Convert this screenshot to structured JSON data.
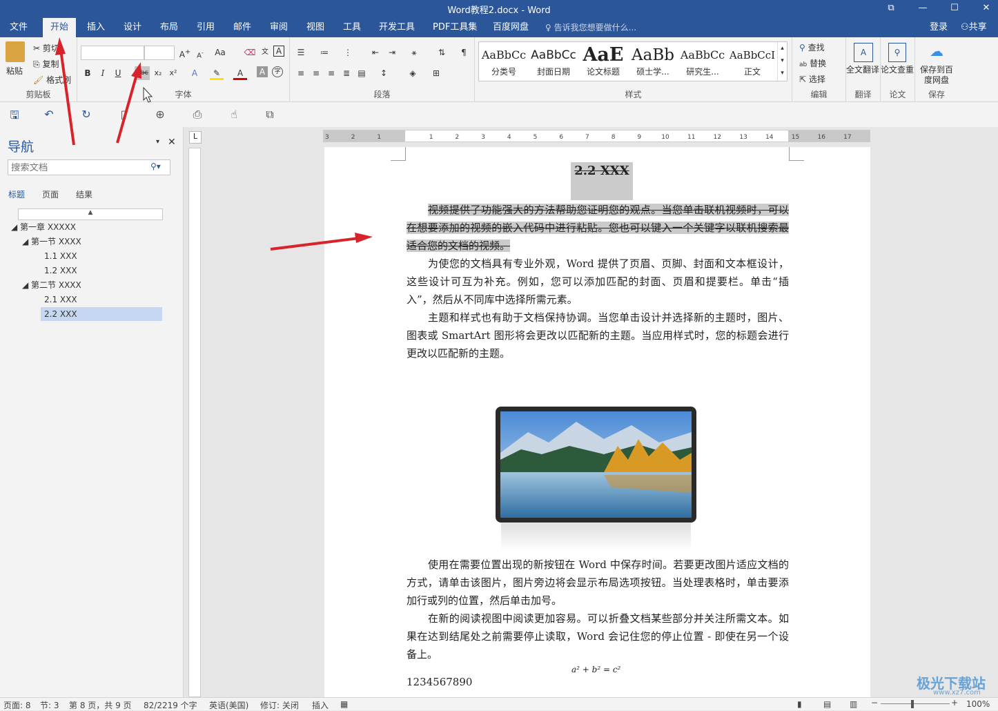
{
  "window": {
    "title": "Word教程2.docx - Word"
  },
  "menu": {
    "tabs": [
      "文件",
      "开始",
      "插入",
      "设计",
      "布局",
      "引用",
      "邮件",
      "审阅",
      "视图",
      "工具",
      "开发工具",
      "PDF工具集",
      "百度网盘"
    ],
    "tell_me": "告诉我您想要做什么...",
    "login": "登录",
    "share": "共享"
  },
  "ribbon": {
    "clipboard": {
      "paste": "粘贴",
      "cut": "剪切",
      "copy": "复制",
      "format_painter": "格式刷",
      "label": "剪贴板"
    },
    "font": {
      "label": "字体",
      "font_name": "",
      "font_size": "",
      "bold": "B",
      "italic": "I",
      "underline": "U",
      "strike": "abc",
      "sub": "x₂",
      "sup": "x²",
      "change_case": "Aa"
    },
    "paragraph": {
      "label": "段落"
    },
    "styles": {
      "label": "样式",
      "items": [
        {
          "preview": "AaBbCc",
          "name": "分类号"
        },
        {
          "preview": "AaBbCc",
          "name": "封面日期"
        },
        {
          "preview": "AaE",
          "name": "论文标题"
        },
        {
          "preview": "AaBb",
          "name": "硕士学..."
        },
        {
          "preview": "AaBbCc",
          "name": "研究生..."
        },
        {
          "preview": "AaBbCcI",
          "name": "正文"
        }
      ]
    },
    "editing": {
      "label": "编辑",
      "find": "查找",
      "replace": "替换",
      "select": "选择"
    },
    "translate": {
      "label": "翻译",
      "btn": "全文翻译"
    },
    "paper": {
      "label": "论文",
      "btn": "论文查重"
    },
    "save": {
      "label": "保存",
      "btn": "保存到百度网盘"
    }
  },
  "navigation": {
    "title": "导航",
    "search_placeholder": "搜索文档",
    "tabs": [
      "标题",
      "页面",
      "结果"
    ],
    "tree": [
      {
        "label": "第一章 XXXXX"
      },
      {
        "label": "第一节 XXXX"
      },
      {
        "label": "1.1 XXX"
      },
      {
        "label": "1.2 XXX"
      },
      {
        "label": "第二节 XXXX"
      },
      {
        "label": "2.1 XXX"
      },
      {
        "label": "2.2 XXX"
      }
    ]
  },
  "document": {
    "heading": "2.2 XXX",
    "p1": "视频提供了功能强大的方法帮助您证明您的观点。当您单击联机视频时，可以在想要添加的视频的嵌入代码中进行粘贴。您也可以键入一个关键字以联机搜索最适合您的文档的视频。",
    "p2": "为使您的文档具有专业外观，Word 提供了页眉、页脚、封面和文本框设计，这些设计可互为补充。例如，您可以添加匹配的封面、页眉和提要栏。单击“插入”，然后从不同库中选择所需元素。",
    "p3": "主题和样式也有助于文档保持协调。当您单击设计并选择新的主题时，图片、图表或 SmartArt 图形将会更改以匹配新的主题。当应用样式时，您的标题会进行更改以匹配新的主题。",
    "p4": "使用在需要位置出现的新按钮在 Word 中保存时间。若要更改图片适应文档的方式，请单击该图片，图片旁边将会显示布局选项按钮。当处理表格时，单击要添加行或列的位置，然后单击加号。",
    "p5": "在新的阅读视图中阅读更加容易。可以折叠文档某些部分并关注所需文本。如果在达到结尾处之前需要停止读取，Word 会记住您的停止位置 - 即使在另一个设备上。",
    "equation": "a² + b² = c²",
    "numbers": "1234567890"
  },
  "ruler": {
    "h_ticks": [
      "3",
      "2",
      "1",
      "1",
      "2",
      "3",
      "4",
      "5",
      "6",
      "7",
      "8",
      "9",
      "10",
      "11",
      "12",
      "13",
      "14",
      "15",
      "16",
      "17"
    ]
  },
  "status": {
    "page": "页面: 8",
    "section": "节: 3",
    "pages": "第 8 页，共 9 页",
    "words": "82/2219 个字",
    "language": "英语(美国)",
    "track": "修订: 关闭",
    "insert": "插入",
    "zoom": "100%"
  },
  "watermark": {
    "text": "极光下载站",
    "url": "www.xz7.com"
  }
}
